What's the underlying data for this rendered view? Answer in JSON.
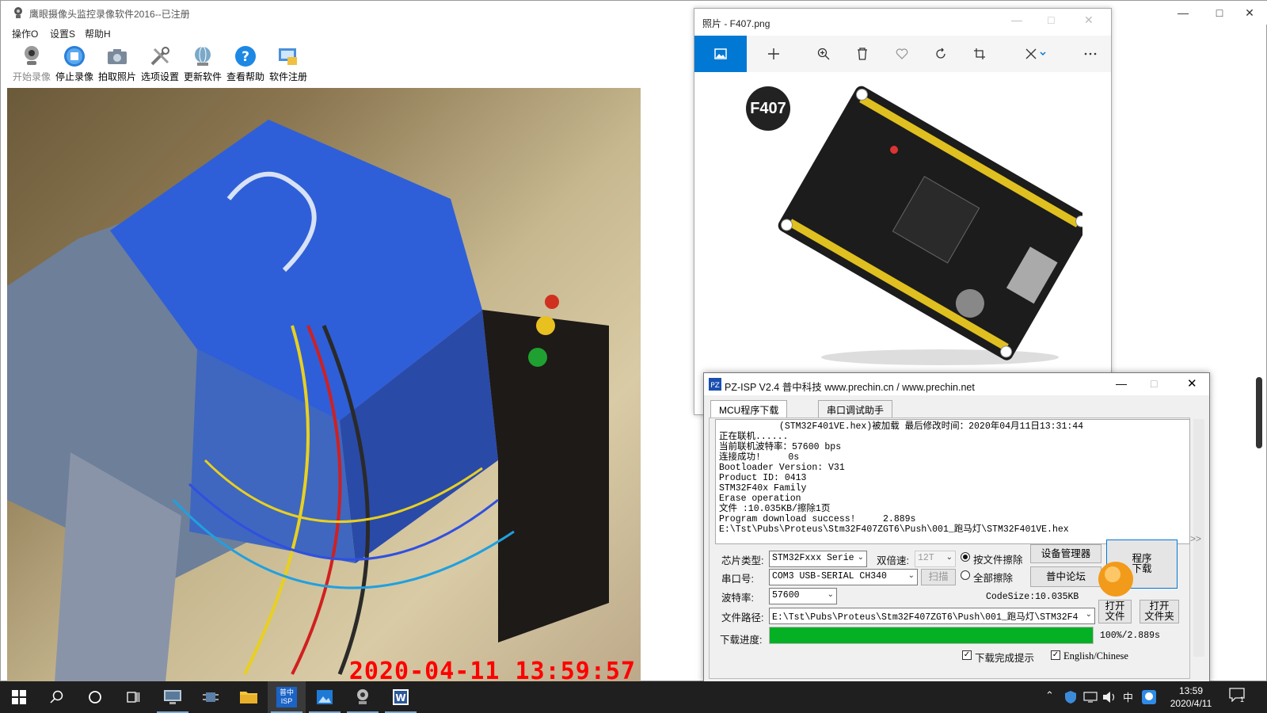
{
  "main": {
    "title": "鹰眼摄像头监控录像软件2016--已注册",
    "menu": [
      "操作O",
      "设置S",
      "帮助H"
    ],
    "toolbar": [
      {
        "label": "开始录像",
        "icon": "webcam-icon",
        "disabled": true
      },
      {
        "label": "停止录像",
        "icon": "stop-icon"
      },
      {
        "label": "拍取照片",
        "icon": "camera-icon"
      },
      {
        "label": "选项设置",
        "icon": "tools-icon"
      },
      {
        "label": "更新软件",
        "icon": "globe-icon"
      },
      {
        "label": "查看帮助",
        "icon": "help-icon"
      },
      {
        "label": "软件注册",
        "icon": "register-icon"
      }
    ],
    "camera_timestamp": "2020-04-11 13:59:57"
  },
  "photos": {
    "title": "照片 - F407.png",
    "board_badge": "F407",
    "toolbar_icons": [
      "image-icon",
      "add-icon",
      "zoom-in-icon",
      "delete-icon",
      "heart-icon",
      "rotate-icon",
      "crop-icon",
      "edit-icon",
      "more-icon"
    ]
  },
  "isp": {
    "title": "PZ-ISP V2.4 普中科技  www.prechin.cn / www.prechin.net",
    "tabs": [
      "MCU程序下载",
      "串口调试助手"
    ],
    "log": "           (STM32F401VE.hex)被加载 最后修改时间：2020年04月11日13:31:44\n正在联机......\n当前联机波特率：57600 bps\n连接成功!     0s\nBootloader Version: V31\nProduct ID: 0413\nSTM32F40x Family\nErase operation\n文件 :10.035KB/擦除1页\nProgram download success!     2.889s\nE:\\Tst\\Pubs\\Proteus\\Stm32F407ZGT6\\Push\\001_跑马灯\\STM32F401VE.hex",
    "chip_label": "芯片类型:",
    "chip_value": "STM32Fxxx Serie",
    "double_speed_label": "双倍速:",
    "double_speed_value": "12T",
    "erase_by_file": "按文件擦除",
    "erase_all": "全部擦除",
    "device_manager": "设备管理器",
    "forum": "普中论坛",
    "download_btn": "程序\n下载",
    "port_label": "串口号:",
    "port_value": "COM3  USB-SERIAL CH340",
    "scan": "扫描",
    "baud_label": "波特率:",
    "baud_value": "57600",
    "codesize": "CodeSize:10.035KB",
    "path_label": "文件路径:",
    "path_value": "E:\\Tst\\Pubs\\Proteus\\Stm32F407ZGT6\\Push\\001_跑马灯\\STM32F4",
    "open_file": "打开\n文件",
    "open_folder": "打开\n文件夹",
    "progress_label": "下载进度:",
    "progress": 1.0,
    "progress_text": "100%/2.889s",
    "notify_label": "下载完成提示",
    "lang_label": "English/Chinese"
  },
  "taskbar": {
    "time": "13:59",
    "date": "2020/4/11",
    "ime": "中",
    "notification_count": "1",
    "isp_label_top": "普中",
    "isp_label_bottom": "ISP"
  }
}
